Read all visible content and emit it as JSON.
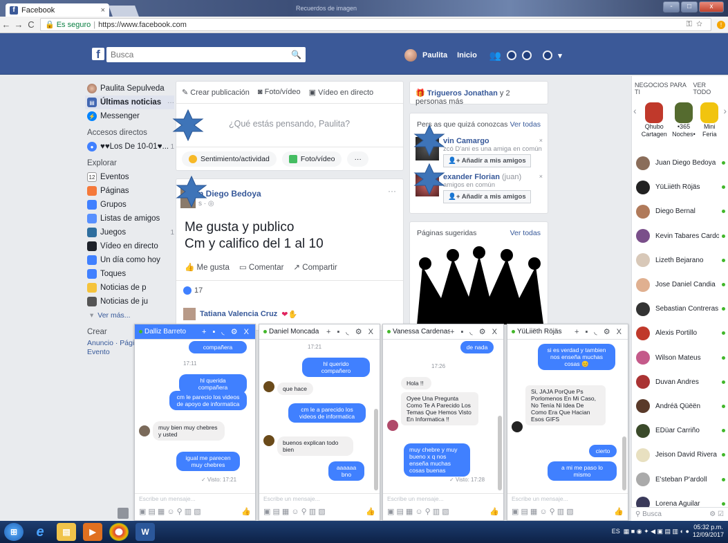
{
  "browser": {
    "tab_title": "Facebook",
    "tab_close": "×",
    "blur_title": "Recuerdos de imagen",
    "secure_label": "Es seguro",
    "url": "https://www.facebook.com",
    "win_min": "-",
    "win_max": "□",
    "win_close": "x"
  },
  "header": {
    "search_placeholder": "Busca",
    "user_name": "Paulita",
    "home": "Inicio"
  },
  "left_nav": {
    "profile": "Paulita Sepulveda",
    "news_feed": "Últimas noticias",
    "news_more": "···",
    "messenger": "Messenger",
    "shortcuts_title": "Accesos directos",
    "shortcut_1": "♥♥Los De 10-01♥...",
    "shortcut_1_count": "1",
    "explore_title": "Explorar",
    "explore_items": [
      {
        "label": "Eventos",
        "count": "",
        "icon": "calendar-icon",
        "color": "#ffffff"
      },
      {
        "label": "Páginas",
        "count": "",
        "icon": "flag-icon",
        "color": "#f5793a"
      },
      {
        "label": "Grupos",
        "count": "",
        "icon": "groups-icon",
        "color": "#4080ff"
      },
      {
        "label": "Listas de amigos",
        "count": "",
        "icon": "friends-list-icon",
        "color": "#5890ff"
      },
      {
        "label": "Juegos",
        "count": "1",
        "icon": "games-icon",
        "color": "#2e6e9e"
      },
      {
        "label": "Vídeo en directo",
        "count": "",
        "icon": "live-video-icon",
        "color": "#1d2129"
      },
      {
        "label": "Un día como hoy",
        "count": "",
        "icon": "memories-icon",
        "color": "#4080ff"
      },
      {
        "label": "Toques",
        "count": "",
        "icon": "pokes-icon",
        "color": "#4080ff"
      },
      {
        "label": "Noticias de p",
        "count": "",
        "icon": "news-icon",
        "color": "#f5c33b"
      },
      {
        "label": "Noticias de ju",
        "count": "",
        "icon": "game-news-icon",
        "color": "#555555"
      }
    ],
    "calendar_day": "12",
    "see_more": "Ver más...",
    "create_title": "Crear",
    "create_links": "Anuncio · Página",
    "create_event": "Evento"
  },
  "composer": {
    "tab_post": "Crear publicación",
    "tab_photo": "Foto/vídeo",
    "tab_live": "Vídeo en directo",
    "placeholder": "¿Qué estás pensando, Paulita?",
    "act_feeling": "Sentimiento/actividad",
    "act_photo": "Foto/vídeo",
    "act_more": "···"
  },
  "post": {
    "author": "n Diego Bedoya",
    "meta": "s · ◎",
    "menu": "···",
    "line1": "Me gusta y publico",
    "line2": "Cm y califico del 1 al 10",
    "like": "Me gusta",
    "comment": "Comentar",
    "share": "Compartir",
    "likes_count": "17",
    "commenter": "Tatiana Valencia Cruz",
    "commenter_emoji": "❤✋"
  },
  "right_col": {
    "notif_name": "Trigueros Jonathan",
    "notif_rest": " y 2 personas más",
    "pymk_title": "Pers   as que quizá conozcas",
    "see_all": "Ver todas",
    "s1_name": "vin Camargo",
    "s1_mutual": "zcó D'ani es una amiga en común",
    "s2_name": "exander Florian",
    "s2_extra": " (juan)",
    "s2_mutual": "amigos en común",
    "add_friend": "Añadir a mis amigos",
    "close_x": "×",
    "pages_title": "Páginas sugeridas",
    "pages_see_all": "Ver todas"
  },
  "business": {
    "title": "NEGOCIOS PARA TI",
    "see_all": "VER TODO",
    "items": [
      {
        "line1": "Qhubo",
        "line2": "Cartagen",
        "color": "#c0392b"
      },
      {
        "line1": "•365",
        "line2": "Noches•",
        "color": "#556b2f"
      },
      {
        "line1": "Mini",
        "line2": "Feria",
        "color": "#f1c40f"
      }
    ]
  },
  "chat_list": {
    "contacts": [
      {
        "name": "Juan Diego Bedoya",
        "color": "#8a6d5a"
      },
      {
        "name": "YüLiiëth Röjäs",
        "color": "#222222"
      },
      {
        "name": "Diego Bernal",
        "color": "#b07a5a"
      },
      {
        "name": "Kevin Tabares Cardo...",
        "color": "#7a4f8a"
      },
      {
        "name": "Lizeth Bejarano",
        "color": "#d8c8b8"
      },
      {
        "name": "Jose Daniel Candia",
        "color": "#e0b090"
      },
      {
        "name": "Sebastian Contreras",
        "color": "#333333"
      },
      {
        "name": "Alexis Portillo",
        "color": "#c0392b"
      },
      {
        "name": "Wilson Mateus",
        "color": "#c45a8a"
      },
      {
        "name": "Duvan Andres",
        "color": "#a33"
      },
      {
        "name": "Ándréä Qüëën",
        "color": "#5a3a2a"
      },
      {
        "name": "EDüar Carriño",
        "color": "#3a4a2a"
      },
      {
        "name": "Jeison David Rivera ...",
        "color": "#e8e0c0"
      },
      {
        "name": "E'steban P'ardoll",
        "color": "#aaa"
      },
      {
        "name": "Lorena Aguilar",
        "color": "#3a3a5a"
      }
    ],
    "search_placeholder": "Busca",
    "search_tools": "⚙ ☑"
  },
  "chats": [
    {
      "name": "Dalliz Barreto",
      "active": true
    },
    {
      "name": "Daniel Moncada",
      "active": false
    },
    {
      "name": "Vanessa Cardenas Pe",
      "active": false
    },
    {
      "name": "YüLiiëth Röjäs",
      "active": false
    }
  ],
  "chat1": {
    "m1": "compañera",
    "ts": "17:11",
    "m2": "hl querida compañera",
    "m3": "cm le parecio los videos de apoyo de informatica",
    "m4": "muy bien muy chebres  y usted",
    "m5": "igual me parecen muy chebres",
    "seen": "✓ Visto: 17:21"
  },
  "chat2": {
    "ts": "17:21",
    "m1": "hl querido compañero",
    "m2": "que hace",
    "m3": "cm le a parecido los videos de informatica",
    "m4": "buenos explican todo bien",
    "m5": "aaaaaa bno"
  },
  "chat3": {
    "m1": "de nada",
    "ts": "17:26",
    "m2": "Hola !!",
    "m3": "Oyee Una Pregunta Como Te A Parecido Los Temas Que Hemos Visto En Informatica !!",
    "m4": "muy chebre y muy bueno x q nos enseña muchas cosas buenas",
    "seen": "✓ Visto: 17:28"
  },
  "chat4": {
    "m1": "si es verdad y tambien nos enseña  muchas cosas 😊",
    "m2": "Si, JAJA PorQue Ps Porlomenos En Mi Caso, No Tenía Ni Idea De Como Era Que Hacian Esos GIFS",
    "m3": "cierto",
    "m4": "a mi me paso lo mismo"
  },
  "chat_common": {
    "input_placeholder": "Escribe un mensaje...",
    "tools": "▣ ▤ ▦ ☺ ⚲ ▥ ▧",
    "thumb": "👍",
    "header_tools": "+ ▪ ◟ ⚙ X"
  },
  "taskbar": {
    "lang": "ES",
    "time": "05:32 p.m.",
    "date": "12/09/2017"
  },
  "colors": {
    "fb_blue": "#3b5998",
    "messenger_blue": "#4080ff",
    "star_blue": "#3e74b8"
  }
}
